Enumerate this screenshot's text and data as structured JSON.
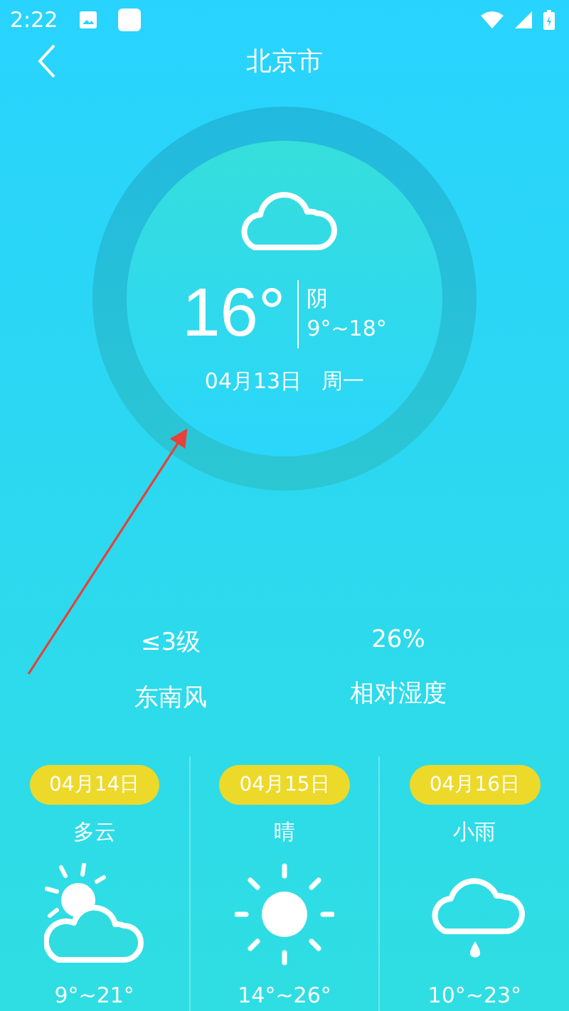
{
  "status_bar": {
    "time": "2:22"
  },
  "header": {
    "title": "北京市"
  },
  "current": {
    "kind": "cloudy",
    "temperature": "16°",
    "condition": "阴",
    "range": "9°~18°",
    "date": "04月13日",
    "weekday": "周一"
  },
  "stats": [
    {
      "value": "≤3级",
      "label": "东南风"
    },
    {
      "value": "26%",
      "label": "相对湿度"
    }
  ],
  "forecast": [
    {
      "date": "04月14日",
      "condition": "多云",
      "kind": "partly-cloudy",
      "range": "9°~21°"
    },
    {
      "date": "04月15日",
      "condition": "晴",
      "kind": "sunny",
      "range": "14°~26°"
    },
    {
      "date": "04月16日",
      "condition": "小雨",
      "kind": "rain",
      "range": "10°~23°"
    }
  ]
}
